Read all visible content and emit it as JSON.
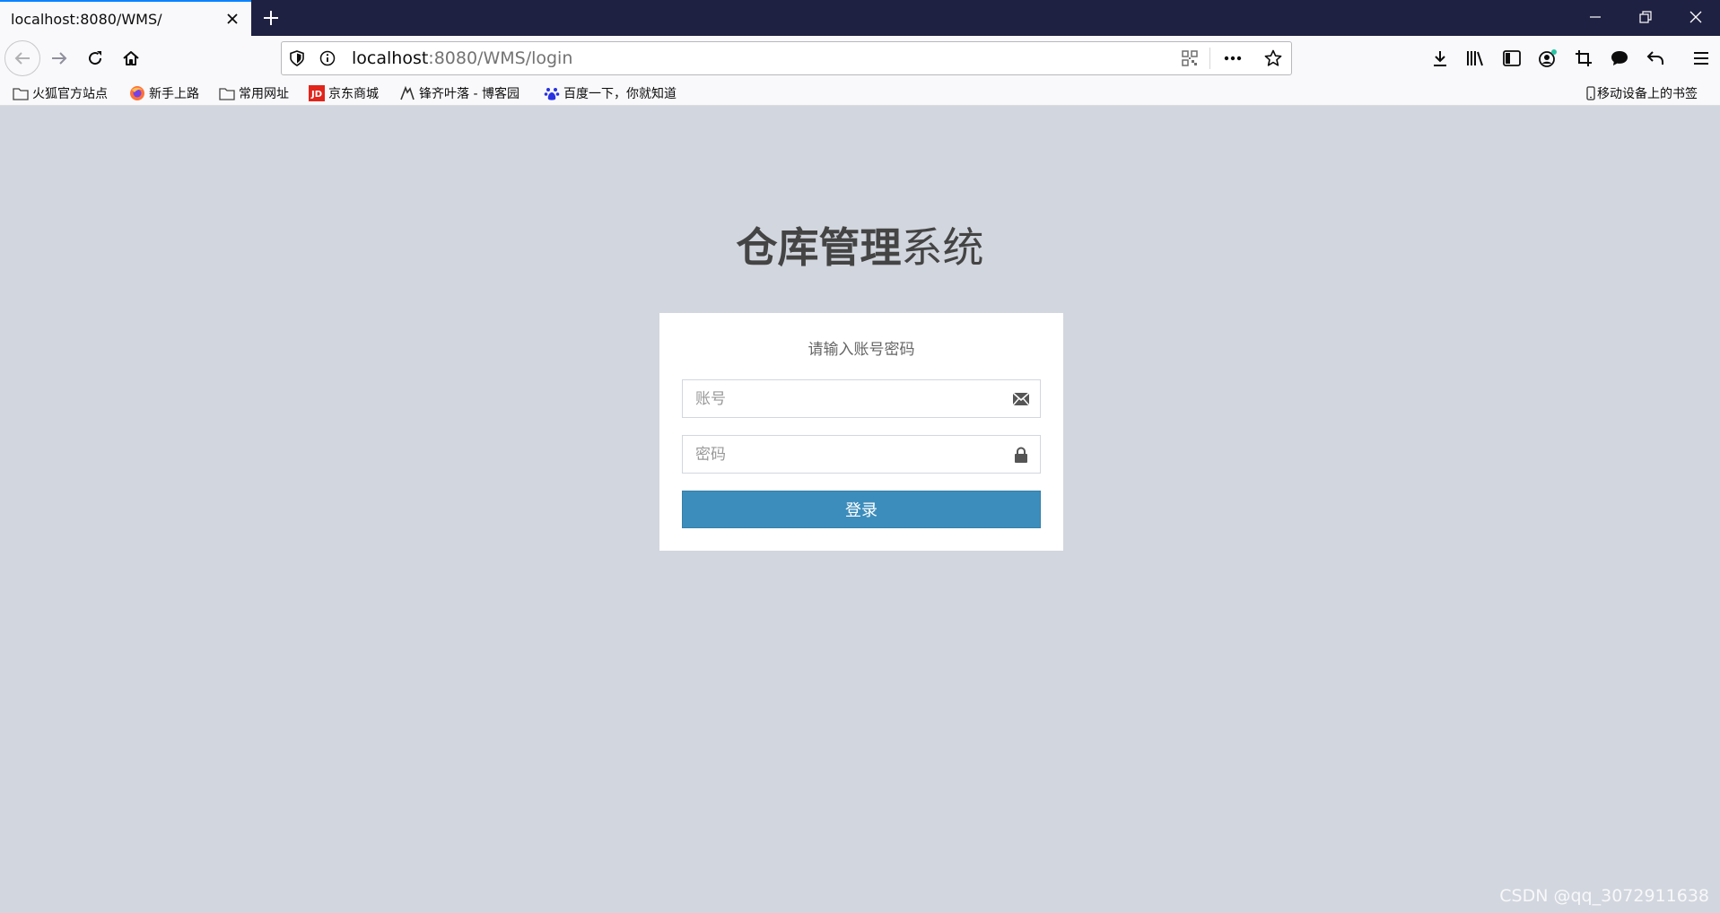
{
  "browser": {
    "tab_title": "localhost:8080/WMS/",
    "url_host": "localhost",
    "url_rest": ":8080/WMS/login",
    "bookmarks": [
      {
        "label": "火狐官方站点",
        "icon": "folder-icon"
      },
      {
        "label": "新手上路",
        "icon": "firefox-icon"
      },
      {
        "label": "常用网址",
        "icon": "folder-icon"
      },
      {
        "label": "京东商城",
        "icon": "jd-icon"
      },
      {
        "label": "锋齐叶落 - 博客园",
        "icon": "cnblogs-icon"
      },
      {
        "label": "百度一下，你就知道",
        "icon": "baidu-paw-icon"
      }
    ],
    "mobile_bookmarks": "移动设备上的书签"
  },
  "login": {
    "logo_bold": "仓库管理",
    "logo_light": "系统",
    "message": "请输入账号密码",
    "username_placeholder": "账号",
    "password_placeholder": "密码",
    "submit_label": "登录"
  },
  "watermark": "CSDN @qq_3072911638",
  "colors": {
    "page_background": "#d2d6de",
    "primary_button": "#3c8dbc",
    "titlebar": "#1f2142",
    "tab_accent": "#0a84ff"
  }
}
